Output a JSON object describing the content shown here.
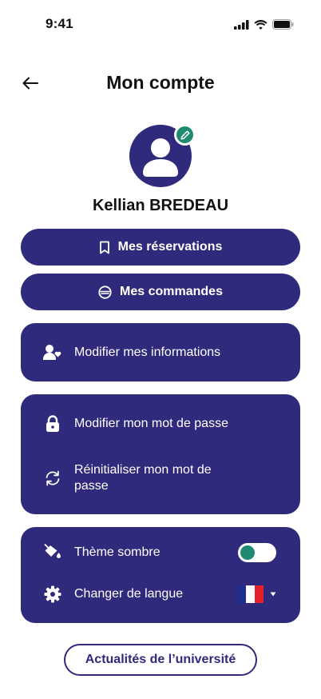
{
  "status_bar": {
    "time": "9:41"
  },
  "header": {
    "title": "Mon compte"
  },
  "user": {
    "name": "Kellian BREDEAU"
  },
  "buttons": {
    "reservations": "Mes réservations",
    "commandes": "Mes commandes"
  },
  "menu": {
    "modifier_infos": "Modifier mes informations",
    "modifier_mdp": "Modifier mon mot de passe",
    "reinit_mdp_line1": "Réinitialiser mon mot de",
    "reinit_mdp_line2": "passe",
    "theme_sombre": "Thème sombre",
    "changer_langue": "Changer de langue"
  },
  "settings": {
    "dark_theme_enabled": true,
    "language_flag": "france-flag-icon"
  },
  "footer": {
    "news_button": "Actualités de l’université"
  },
  "colors": {
    "primary": "#2f2a7b",
    "accent": "#1f8a72",
    "background": "#ffffff"
  }
}
